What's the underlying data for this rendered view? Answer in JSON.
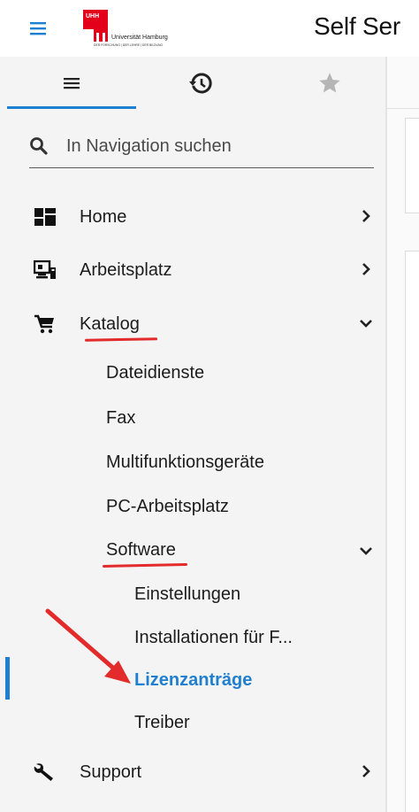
{
  "header": {
    "title": "Self Ser",
    "logo_text_line1": "Universität Hamburg",
    "logo_text_line2": "DER FORSCHUNG | DER LEHRE | DER BILDUNG",
    "logo_badge": "UHH",
    "menu_icon": "hamburger-icon"
  },
  "colors": {
    "accent": "#1f7fd1",
    "annotation_red": "#e32b2b",
    "logo_red": "#e2001a",
    "sidebar_bg": "#f4f4f4"
  },
  "sidebar": {
    "tabs": [
      {
        "icon": "list-icon",
        "active": true
      },
      {
        "icon": "history-icon",
        "active": false
      },
      {
        "icon": "star-icon",
        "active": false
      }
    ],
    "search": {
      "placeholder": "In Navigation suchen",
      "icon": "search-icon"
    },
    "items": [
      {
        "label": "Home",
        "icon": "dashboard-icon",
        "chevron": "right"
      },
      {
        "label": "Arbeitsplatz",
        "icon": "workstation-icon",
        "chevron": "right"
      },
      {
        "label": "Katalog",
        "icon": "cart-icon",
        "chevron": "down",
        "expanded": true
      },
      {
        "label": "Support",
        "icon": "wrench-icon",
        "chevron": "right"
      }
    ],
    "katalog_children": [
      {
        "label": "Dateidienste"
      },
      {
        "label": "Fax"
      },
      {
        "label": "Multifunktionsgeräte"
      },
      {
        "label": "PC-Arbeitsplatz"
      },
      {
        "label": "Software",
        "chevron": "down",
        "expanded": true
      }
    ],
    "software_children": [
      {
        "label": "Einstellungen"
      },
      {
        "label": "Installationen für F..."
      },
      {
        "label": "Lizenzanträge",
        "active": true
      },
      {
        "label": "Treiber"
      }
    ]
  }
}
